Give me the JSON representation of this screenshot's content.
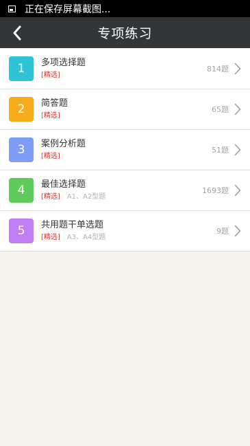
{
  "status_bar": {
    "text": "正在保存屏幕截图..."
  },
  "header": {
    "title": "专项练习"
  },
  "items": [
    {
      "number": "1",
      "title": "多项选择题",
      "tag": "[精选]",
      "subtitle": "",
      "count": "814题",
      "color": "#2ec3d6"
    },
    {
      "number": "2",
      "title": "简答题",
      "tag": "[精选]",
      "subtitle": "",
      "count": "65题",
      "color": "#f6ac18"
    },
    {
      "number": "3",
      "title": "案例分析题",
      "tag": "[精选]",
      "subtitle": "",
      "count": "51题",
      "color": "#7f9cf7"
    },
    {
      "number": "4",
      "title": "最佳选择题",
      "tag": "[精选]",
      "subtitle": "A1、A2型题",
      "count": "1693题",
      "color": "#5dcc5b"
    },
    {
      "number": "5",
      "title": "共用题干单选题",
      "tag": "[精选]",
      "subtitle": "A3、A4型题",
      "count": "9题",
      "color": "#c17df2"
    }
  ]
}
